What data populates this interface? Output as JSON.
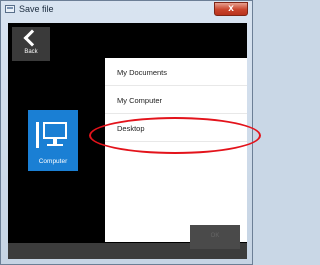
{
  "window": {
    "title": "Save file",
    "close_glyph": "x",
    "icon": "save-file-window-icon",
    "colors": {
      "tile_blue": "#1a7fd4",
      "annotation_red": "#e3131b",
      "close_red": "#c9442c"
    }
  },
  "nav": {
    "back_label": "Back",
    "back_icon": "chevron-left-icon"
  },
  "tile": {
    "label": "Computer",
    "icon": "monitor-icon"
  },
  "locations": [
    {
      "label": "My Documents"
    },
    {
      "label": "My Computer"
    },
    {
      "label": "Desktop",
      "highlighted": true
    }
  ],
  "footer": {
    "ok_label": "OK",
    "ok_enabled": false
  }
}
